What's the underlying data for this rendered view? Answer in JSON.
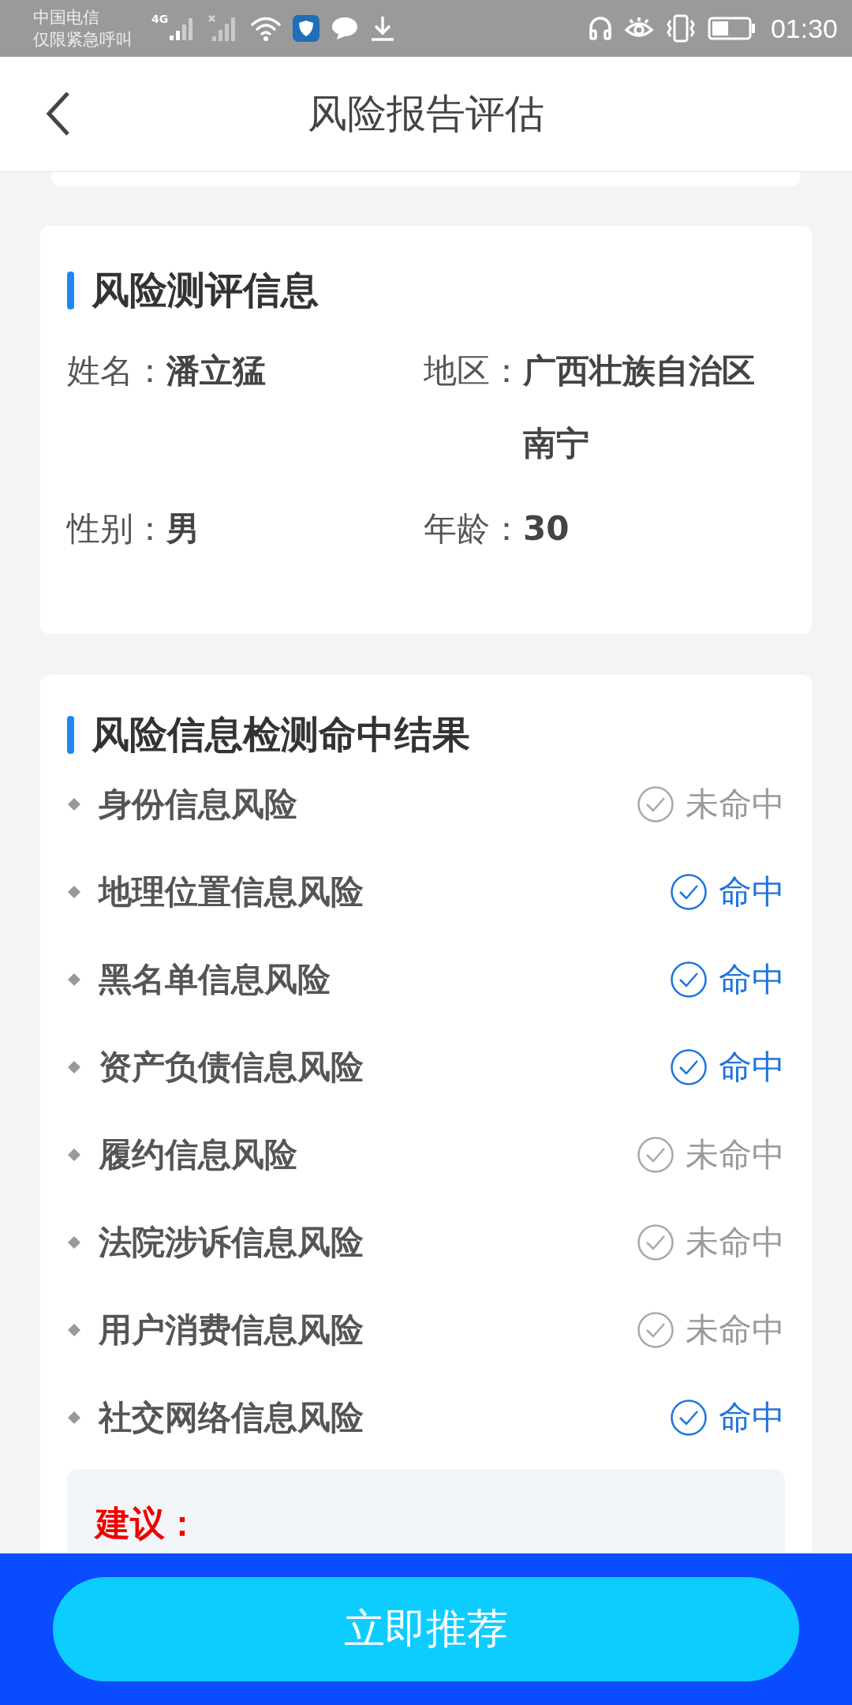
{
  "status_bar": {
    "carrier": "中国电信",
    "emergency": "仅限紧急呼叫",
    "network": "4G",
    "time": "01:30"
  },
  "header": {
    "title": "风险报告评估"
  },
  "info_card": {
    "title": "风险测评信息",
    "fields": [
      {
        "label": "姓名：",
        "value": "潘立猛"
      },
      {
        "label": "地区：",
        "value": "广西壮族自治区南宁"
      },
      {
        "label": "性别：",
        "value": "男"
      },
      {
        "label": "年龄：",
        "value": "30"
      }
    ]
  },
  "result_card": {
    "title": "风险信息检测命中结果",
    "items": [
      {
        "name": "身份信息风险",
        "hit": false,
        "status": "未命中"
      },
      {
        "name": "地理位置信息风险",
        "hit": true,
        "status": "命中"
      },
      {
        "name": "黑名单信息风险",
        "hit": true,
        "status": "命中"
      },
      {
        "name": "资产负债信息风险",
        "hit": true,
        "status": "命中"
      },
      {
        "name": "履约信息风险",
        "hit": false,
        "status": "未命中"
      },
      {
        "name": "法院涉诉信息风险",
        "hit": false,
        "status": "未命中"
      },
      {
        "name": "用户消费信息风险",
        "hit": false,
        "status": "未命中"
      },
      {
        "name": "社交网络信息风险",
        "hit": true,
        "status": "命中"
      }
    ],
    "advice_label": "建议："
  },
  "bottom_button": {
    "label": "立即推荐"
  }
}
